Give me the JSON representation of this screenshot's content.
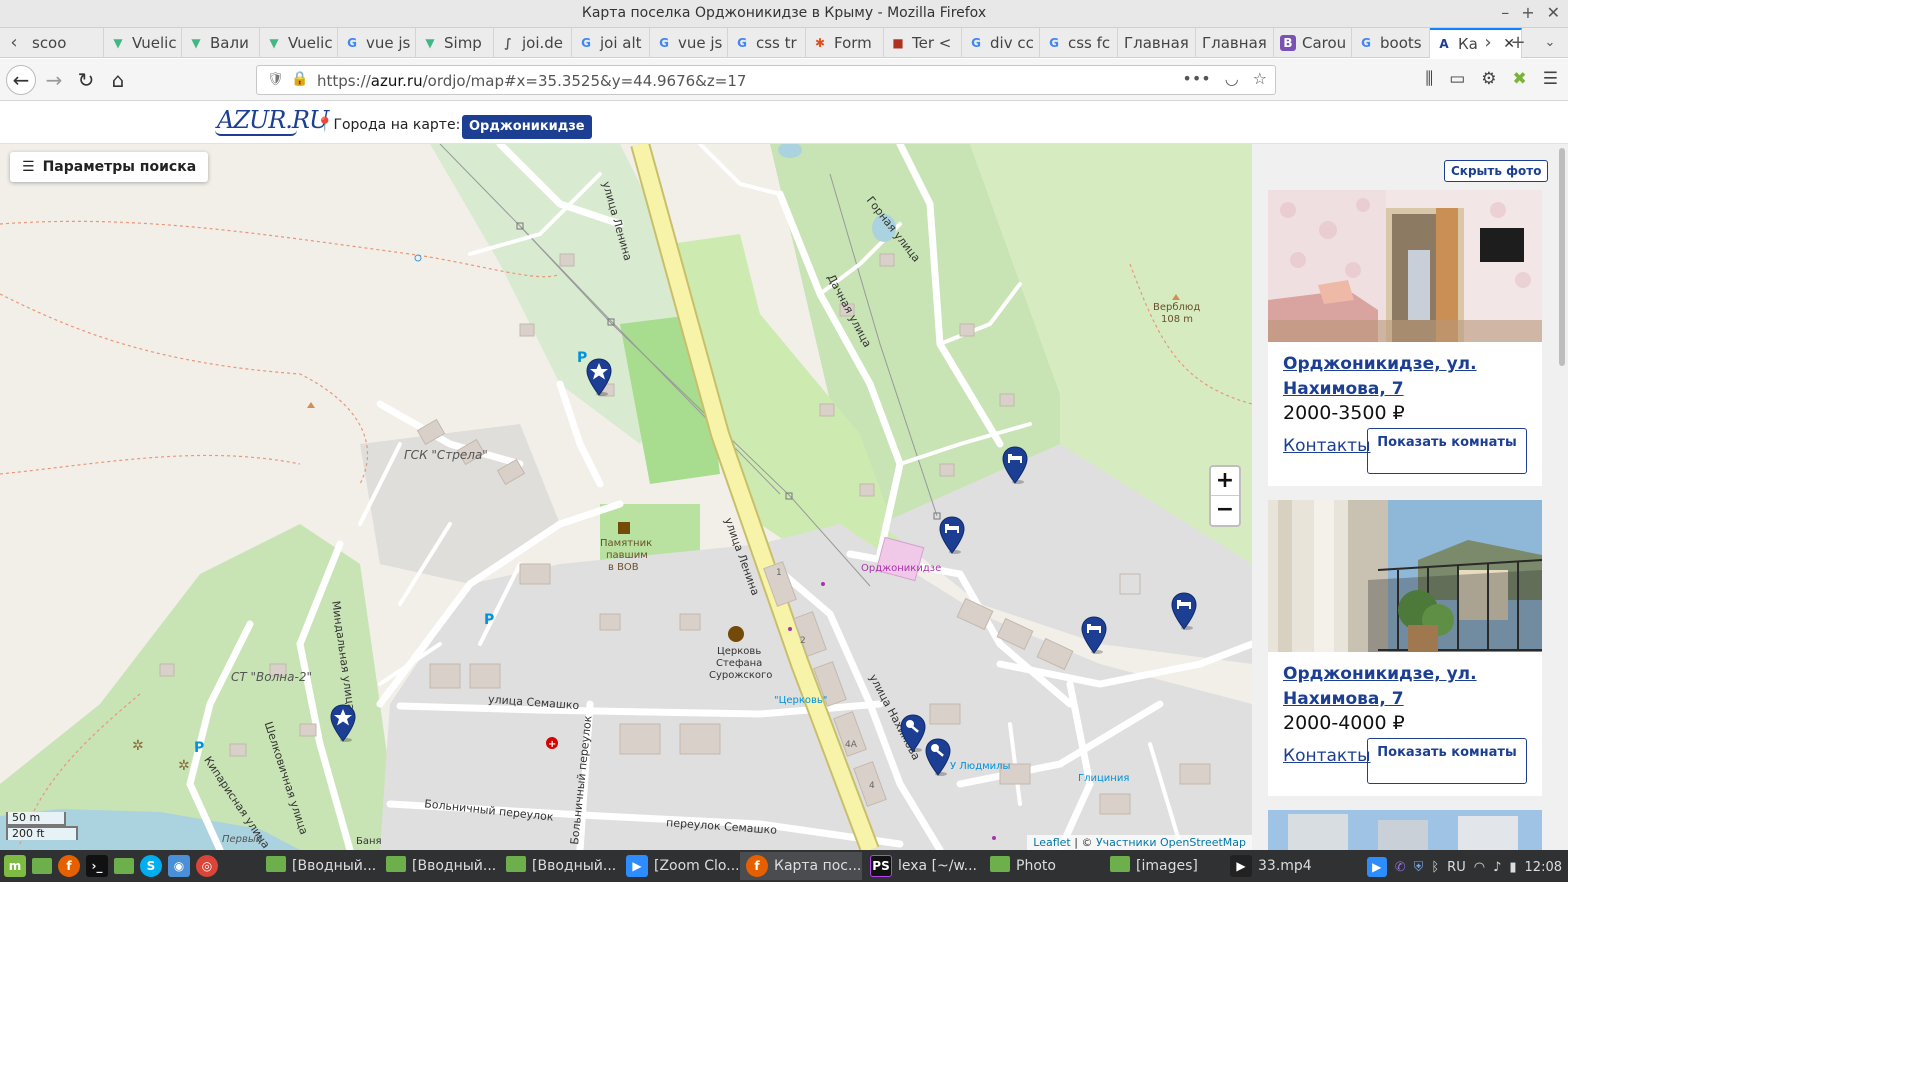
{
  "window": {
    "title": "Карта поселка Орджоникидзе в Крыму - Mozilla Firefox"
  },
  "tabs": [
    {
      "label": "scoo",
      "icon": "none"
    },
    {
      "label": "Vuelic",
      "icon": "vue-icon"
    },
    {
      "label": "Вали",
      "icon": "vue-icon"
    },
    {
      "label": "Vuelic",
      "icon": "vue-icon"
    },
    {
      "label": "vue js",
      "icon": "google-icon"
    },
    {
      "label": "Simp",
      "icon": "vue-icon"
    },
    {
      "label": "joi.de",
      "icon": "joi-icon"
    },
    {
      "label": "joi alt",
      "icon": "google-icon"
    },
    {
      "label": "vue js",
      "icon": "google-icon"
    },
    {
      "label": "css tr",
      "icon": "google-icon"
    },
    {
      "label": "Form",
      "icon": "asterisk-icon"
    },
    {
      "label": "Ter <",
      "icon": "site-icon"
    },
    {
      "label": "div cc",
      "icon": "google-icon"
    },
    {
      "label": "css fc",
      "icon": "google-icon"
    },
    {
      "label": "Главная",
      "icon": "none"
    },
    {
      "label": "Главная",
      "icon": "none"
    },
    {
      "label": "Carou",
      "icon": "bootstrap-icon"
    },
    {
      "label": "boots",
      "icon": "google-icon"
    },
    {
      "label": "Ка",
      "icon": "azur-icon",
      "active": true
    }
  ],
  "nav": {
    "url": "https://azur.ru/ordjo/map#x=35.3525&y=44.9676&z=17",
    "url_host": "azur.ru",
    "url_pre": "https://",
    "url_post": "/ordjo/map#x=35.3525&y=44.9676&z=17"
  },
  "site": {
    "logo": "AZUR.RU",
    "cities_label": "Города на карте:",
    "city_button": "Орджоникидзе"
  },
  "map": {
    "params_button": "Параметры поиска",
    "zoom_in": "+",
    "zoom_out": "−",
    "scale_m": "50 m",
    "scale_ft": "200 ft",
    "attribution_leaflet": "Leaflet",
    "attribution_sep": " | © ",
    "attribution_osm": "Участники OpenStreetMap",
    "labels": {
      "ulitsa_lenina": "улица Ленина",
      "ulitsa_lenina2": "улица Ленина",
      "gornaya": "Горная улица",
      "dachnaya": "Дачная улица",
      "verblyud": "Верблюд",
      "verblyud_h": "108 m",
      "gsk": "ГСК \"Стрела\"",
      "pamyatnik1": "Памятник",
      "pamyatnik2": "павшим",
      "pamyatnik3": "в ВОВ",
      "ordzh": "Орджоникидзе",
      "tserkov1": "Церковь",
      "tserkov2": "Стефана",
      "tserkov3": "Сурожского",
      "tserkov_stop": "\"Церковь\"",
      "semashko": "улица Семашко",
      "bolnichny": "Больничный переулок",
      "bolnichny2": "Больничный переулок",
      "per_semashko": "переулок Семашко",
      "mindalnaya": "Миндальная улица",
      "volna": "СТ \"Волна-2\"",
      "shelkovichnaya": "Шелковичная улица",
      "kiparisnaya": "Кипарисная улица",
      "nakhimova": "улица Нахимова",
      "u_lyudmily": "У Людмилы",
      "glitsiniya": "Глициния",
      "banya": "Баня",
      "perviy": "Первый",
      "n1": "1",
      "n2": "2",
      "n4a": "4А",
      "n4": "4"
    }
  },
  "sidebar": {
    "hide_photo": "Скрыть фото",
    "listings": [
      {
        "address": "Орджоникидзе, ул. Нахимова, 7",
        "price": "2000-3500 ₽",
        "contacts": "Контакты",
        "rooms": "Показать комнаты"
      },
      {
        "address": "Орджоникидзе, ул. Нахимова, 7",
        "price": "2000-4000 ₽",
        "contacts": "Контакты",
        "rooms": "Показать комнаты"
      }
    ]
  },
  "taskbar": {
    "tasks": [
      {
        "label": "[Вводный...",
        "icon": "folder-icon"
      },
      {
        "label": "[Вводный...",
        "icon": "folder-icon"
      },
      {
        "label": "[Вводный...",
        "icon": "folder-icon"
      },
      {
        "label": "[Zoom Clo...",
        "icon": "zoom-icon"
      },
      {
        "label": "Карта пос...",
        "icon": "firefox-icon",
        "active": true
      },
      {
        "label": "lexa [~/w...",
        "icon": "phpstorm-icon"
      },
      {
        "label": "Photo",
        "icon": "folder-icon"
      },
      {
        "label": "[images]",
        "icon": "folder-icon"
      },
      {
        "label": "33.mp4",
        "icon": "play-icon"
      }
    ],
    "lang": "RU",
    "clock": "12:08"
  },
  "colors": {
    "brand_blue": "#1c3f93",
    "map_bg": "#f2efe9",
    "park_green": "#c8e3b4",
    "road_yellow": "#f7f3a9",
    "residential": "#e0dfdf",
    "firefox_blue": "#0a84ff"
  }
}
